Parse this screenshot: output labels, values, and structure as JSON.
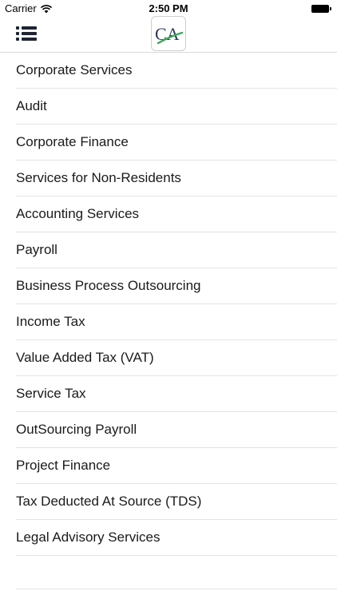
{
  "status_bar": {
    "carrier": "Carrier",
    "time": "2:50 PM",
    "wifi_icon": "wifi-icon",
    "battery_icon": "battery-icon"
  },
  "nav": {
    "menu_icon": "list-menu-icon",
    "logo_text": "CA"
  },
  "colors": {
    "logo_dark": "#2b3a5c",
    "logo_green": "#3aa655",
    "divider": "#e3e3e3"
  },
  "services": [
    "Corporate Services",
    "Audit",
    "Corporate Finance",
    "Services for Non-Residents",
    "Accounting Services",
    "Payroll",
    "Business Process Outsourcing",
    "Income Tax",
    "Value Added Tax (VAT)",
    "Service Tax",
    "OutSourcing Payroll",
    "Project Finance",
    "Tax Deducted At Source (TDS)",
    "Legal Advisory Services"
  ]
}
